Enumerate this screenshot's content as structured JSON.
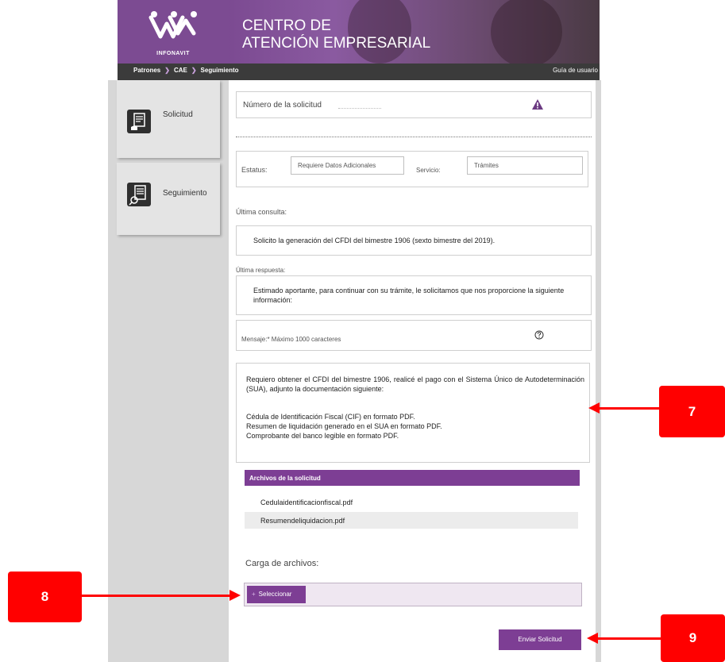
{
  "header": {
    "logo_text": "INFONAVIT",
    "title_line1": "CENTRO DE",
    "title_line2": "ATENCIÓN EMPRESARIAL"
  },
  "breadcrumb": {
    "items": [
      "Patrones",
      "CAE",
      "Seguimiento"
    ],
    "guide_link": "Guía de usuario"
  },
  "sidebar": {
    "items": [
      {
        "label": "Solicitud",
        "icon": "document-hand-icon"
      },
      {
        "label": "Seguimiento",
        "icon": "document-search-icon"
      }
    ]
  },
  "request": {
    "number_label": "Número de la solicitud",
    "status_label": "Estatus:",
    "status_value": "Requiere Datos Adicionales",
    "service_label": "Servicio:",
    "service_value": "Trámites",
    "last_query_label": "Última consulta:",
    "last_query_text": "Solicito la generación del CFDI del bimestre 1906 (sexto bimestre del 2019).",
    "last_response_label": "Última respuesta:",
    "last_response_text": "Estimado aportante, para continuar con su trámite, le solicitamos que nos proporcione la siguiente información:",
    "message_label": "Mensaje:* Máximo 1000 caracteres",
    "message_p1": "Requiero obtener el CFDI del bimestre 1906, realicé el pago con el Sistema Único de Autodeterminación (SUA), adjunto la documentación siguiente:",
    "message_l1": "Cédula de Identificación Fiscal (CIF) en formato PDF.",
    "message_l2": "Resumen de liquidación generado en el SUA en formato PDF.",
    "message_l3": "Comprobante del banco legible en formato PDF."
  },
  "files": {
    "header": "Archivos de la solicitud",
    "items": [
      "Cedulaidentificacionfiscal.pdf",
      "Resumendeliquidacion.pdf"
    ]
  },
  "upload": {
    "label": "Carga de archivos:",
    "select_button": "Seleccionar"
  },
  "actions": {
    "send_button": "Enviar Solicitud"
  },
  "callouts": [
    "7",
    "8",
    "9"
  ],
  "colors": {
    "brand_purple": "#7d3e94",
    "callout_red": "#ff0000",
    "warning_icon": "#6b3a82"
  }
}
